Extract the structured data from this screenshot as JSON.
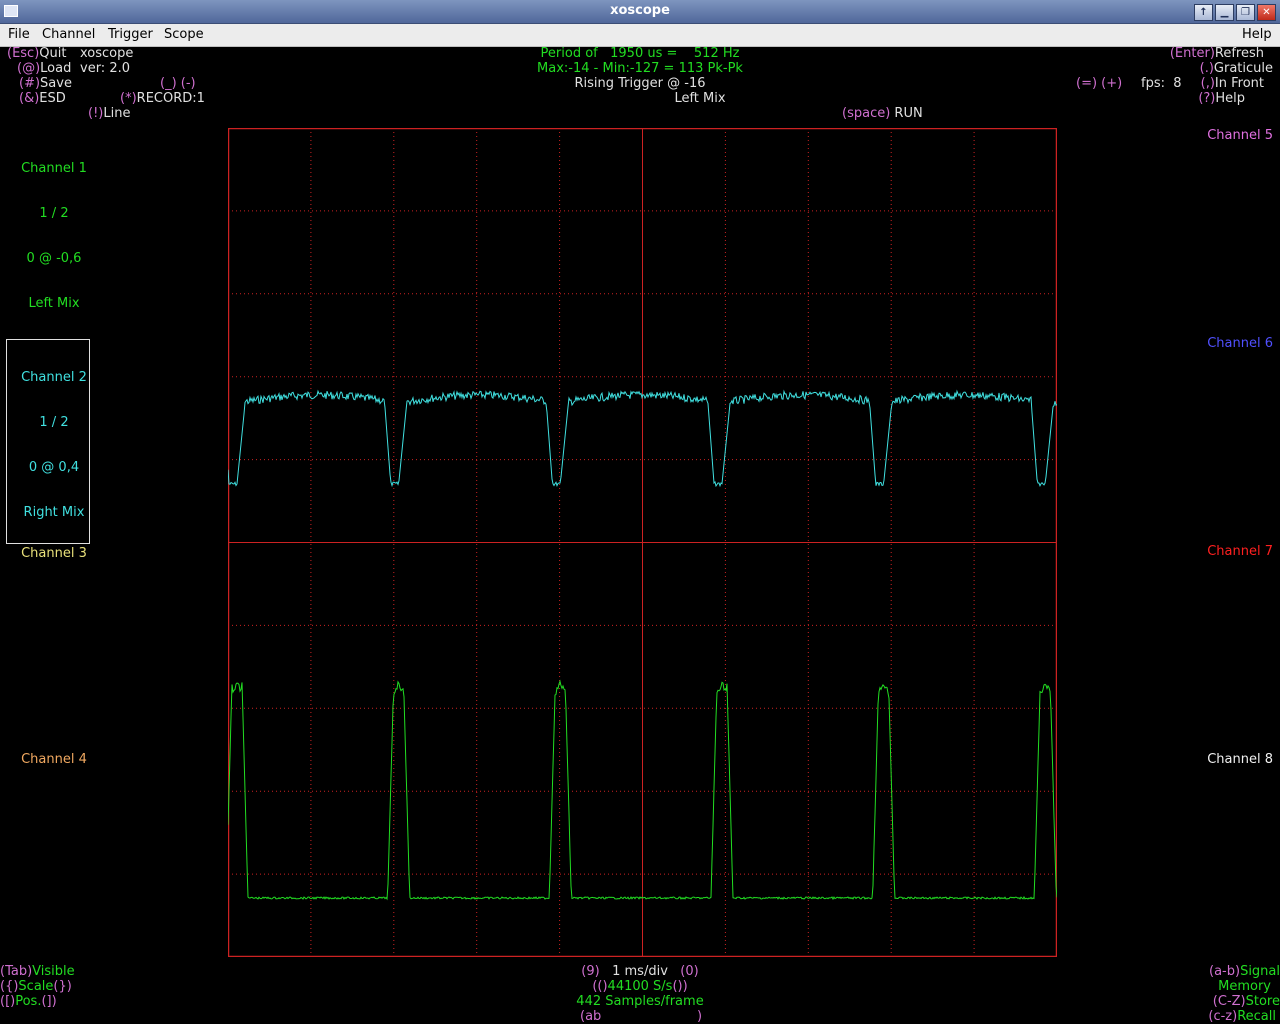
{
  "window": {
    "title": "xoscope",
    "buttons": [
      "↑",
      "▁",
      "❐",
      "✕"
    ]
  },
  "menubar": {
    "items": [
      "File",
      "Channel",
      "Trigger",
      "Scope"
    ],
    "help": "Help"
  },
  "left_keys": {
    "quit_key": "(Esc)",
    "quit": "Quit",
    "app_name": "xoscope",
    "load_key": "(@)",
    "load": "Load",
    "version": "ver: 2.0",
    "save_key": "(#)",
    "save": "Save",
    "underscore_minus": "(_) (-)",
    "esd_key": "(&)",
    "esd": "ESD",
    "record_key": "(*)",
    "record": "RECORD:1",
    "line_key": "(!)",
    "line": "Line"
  },
  "center_status": {
    "period": "Period of   1950 us =    512 Hz",
    "maxmin": "Max:-14 - Min:-127 = 113 Pk-Pk",
    "trigger": "Rising Trigger @ -16",
    "source": "Left Mix",
    "run_key": "(space)",
    "run": "RUN"
  },
  "right_keys": {
    "refresh_key": "(Enter)",
    "refresh": "Refresh",
    "graticule_key": "(.)",
    "graticule": "Graticule",
    "eq_plus": "(=) (+)",
    "fps": "fps:  8",
    "front_key": "(,)",
    "front": "In Front",
    "help_key": "(?)",
    "help": "Help"
  },
  "channels_left": {
    "ch1": {
      "name": "Channel 1",
      "scale": "1 / 2",
      "pos": "0 @ -0,6",
      "source": "Left Mix",
      "color": "#22dd22"
    },
    "ch2": {
      "name": "Channel 2",
      "scale": "1 / 2",
      "pos": "0 @ 0,4",
      "source": "Right Mix",
      "color": "#40e0e0"
    },
    "ch3": {
      "name": "Channel 3",
      "color": "#e8e07a"
    },
    "ch4": {
      "name": "Channel 4",
      "color": "#f0a860"
    }
  },
  "channels_right": {
    "ch5": {
      "name": "Channel 5",
      "color": "#e070e0"
    },
    "ch6": {
      "name": "Channel 6",
      "color": "#5050ff"
    },
    "ch7": {
      "name": "Channel 7",
      "color": "#ff2020"
    },
    "ch8": {
      "name": "Channel 8",
      "color": "#f0f0f0"
    }
  },
  "bottom_left": {
    "visible_key": "(Tab)",
    "visible": "Visible",
    "scale_key1": "({)",
    "scale": "Scale",
    "scale_key2": "(})",
    "pos_key1": "([)",
    "pos": "Pos.",
    "pos_key2": "(])"
  },
  "bottom_center": {
    "timebase_key1": "(9)",
    "timebase": "1 ms/div",
    "timebase_key2": "(0)",
    "rate_key1": "(()",
    "rate": "44100 S/s",
    "rate_key2": "())",
    "samples": "442 Samples/frame",
    "ab_open": "(ab",
    "ab_close": ")"
  },
  "bottom_right": {
    "signal_key": "(a-b)",
    "signal": "Signal",
    "memory": "Memory",
    "store_key": "(C-Z)",
    "store": "Store",
    "recall_key": "(c-z)",
    "recall": "Recall"
  },
  "colors": {
    "graticule": "#cc2222",
    "trace_ch1": "#22dd22",
    "trace_ch2": "#40e0e0",
    "key": "#d070d0"
  },
  "scope": {
    "divisions": 10,
    "signal_period_ms": 1.95,
    "time_per_div_ms": 1
  }
}
